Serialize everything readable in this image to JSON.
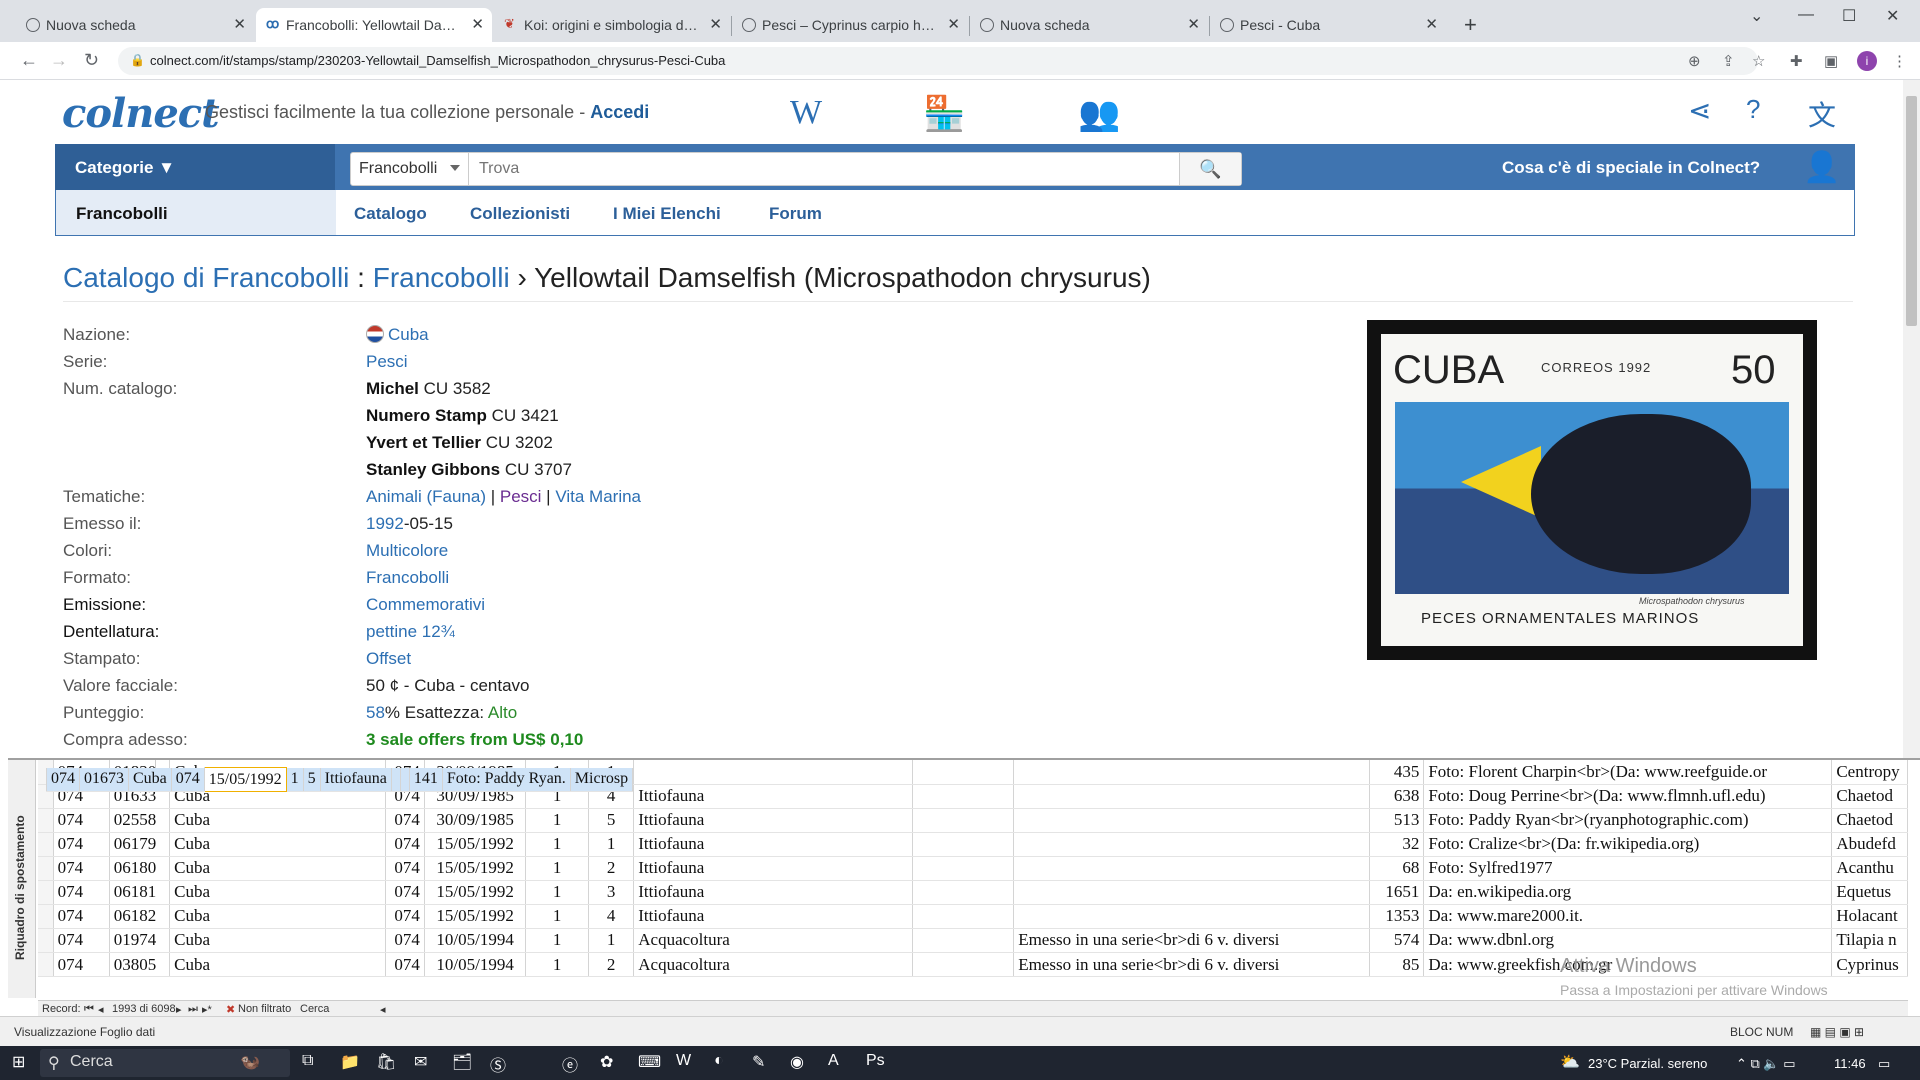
{
  "browser": {
    "tabs": [
      {
        "title": "Nuova scheda",
        "icon": "globe-icon"
      },
      {
        "title": "Francobolli: Yellowtail Damselfish",
        "icon": "colnect-icon"
      },
      {
        "title": "Koi: origini e simbologia della ca",
        "icon": "koi-icon"
      },
      {
        "title": "Pesci – Cyprinus carpio haemator",
        "icon": "globe-icon"
      },
      {
        "title": "Nuova scheda",
        "icon": "globe-icon"
      },
      {
        "title": "Pesci - Cuba",
        "icon": "globe-icon"
      }
    ],
    "url": "colnect.com/it/stamps/stamp/230203-Yellowtail_Damselfish_Microspathodon_chrysurus-Pesci-Cuba",
    "avatar_letter": "i"
  },
  "header": {
    "logo": "colnect",
    "tagline": "Gestisci facilmente la tua collezione personale - ",
    "login": "Accedi",
    "w_icon": "W"
  },
  "searchbar": {
    "categories_label": "Categorie ▼",
    "select_value": "Francobolli",
    "placeholder": "Trova",
    "special": "Cosa c'è di speciale in Colnect?"
  },
  "subnav": {
    "current": "Francobolli",
    "links": [
      "Catalogo",
      "Collezionisti",
      "I Miei Elenchi",
      "Forum"
    ]
  },
  "breadcrumb": {
    "part1": "Catalogo di Francobolli",
    "sep1": " : ",
    "part2": "Francobolli",
    "sep2": " › ",
    "title": "Yellowtail Damselfish (Microspathodon chrysurus)"
  },
  "details": {
    "nazione_label": "Nazione:",
    "nazione": "Cuba",
    "serie_label": "Serie:",
    "serie": "Pesci",
    "numcat_label": "Num. catalogo:",
    "catalogs": [
      {
        "name": "Michel",
        "code": " CU 3582"
      },
      {
        "name": "Numero Stamp",
        "code": " CU 3421"
      },
      {
        "name": "Yvert et Tellier",
        "code": " CU 3202"
      },
      {
        "name": "Stanley Gibbons",
        "code": " CU 3707"
      }
    ],
    "tematiche_label": "Tematiche:",
    "tematiche": [
      "Animali (Fauna)",
      "Pesci",
      "Vita Marina"
    ],
    "tematiche_sep": " | ",
    "emesso_label": "Emesso il:",
    "emesso_year": "1992",
    "emesso_rest": "-05-15",
    "colori_label": "Colori:",
    "colori": "Multicolore",
    "formato_label": "Formato:",
    "formato": "Francobolli",
    "emissione_label": "Emissione:",
    "emissione": "Commemorativi",
    "dentellatura_label": "Dentellatura:",
    "dentellatura": "pettine 12¾",
    "stampato_label": "Stampato:",
    "stampato": "Offset",
    "valore_label": "Valore facciale:",
    "valore": "50 ¢ - Cuba - centavo",
    "punteggio_label": "Punteggio:",
    "punteggio_pct": "58",
    "punteggio_mid": "% Esattezza: ",
    "punteggio_acc": "Alto",
    "compra_label": "Compra adesso:",
    "compra": "3 sale offers from US$  0,10"
  },
  "stamp": {
    "country": "CUBA",
    "correos": "CORREOS 1992",
    "value": "50",
    "scientific": "Microspathodon chrysurus",
    "caption": "PECES ORNAMENTALES MARINOS"
  },
  "access": {
    "nav_pane_label": "Riquadro di spostamento",
    "rows": [
      [
        "074",
        "01830",
        "Cuba",
        "074",
        "30/09/1985",
        "1",
        "1",
        "",
        "",
        "",
        "435",
        "Foto: Florent Charpin<br>(Da: www.reefguide.or",
        "Centropy"
      ],
      [
        "074",
        "01633",
        "Cuba",
        "074",
        "30/09/1985",
        "1",
        "4",
        "Ittiofauna",
        "",
        "",
        "638",
        "Foto: Doug Perrine<br>(Da: www.flmnh.ufl.edu)",
        "Chaetod"
      ],
      [
        "074",
        "02558",
        "Cuba",
        "074",
        "30/09/1985",
        "1",
        "5",
        "Ittiofauna",
        "",
        "",
        "513",
        "Foto: Paddy Ryan<br>(ryanphotographic.com)",
        "Chaetod"
      ],
      [
        "074",
        "06179",
        "Cuba",
        "074",
        "15/05/1992",
        "1",
        "1",
        "Ittiofauna",
        "",
        "",
        "32",
        "Foto: Cralize<br>(Da: fr.wikipedia.org)",
        "Abudefd"
      ],
      [
        "074",
        "06180",
        "Cuba",
        "074",
        "15/05/1992",
        "1",
        "2",
        "Ittiofauna",
        "",
        "",
        "68",
        "Foto: Sylfred1977",
        "Acanthu"
      ],
      [
        "074",
        "06181",
        "Cuba",
        "074",
        "15/05/1992",
        "1",
        "3",
        "Ittiofauna",
        "",
        "",
        "1651",
        "Da: en.wikipedia.org",
        "Equetus"
      ],
      [
        "074",
        "06182",
        "Cuba",
        "074",
        "15/05/1992",
        "1",
        "4",
        "Ittiofauna",
        "",
        "",
        "1353",
        "Da: www.mare2000.it.",
        "Holacant"
      ],
      [
        "074",
        "01673",
        "Cuba",
        "074",
        "15/05/1992",
        "1",
        "5",
        "Ittiofauna",
        "",
        "",
        "141",
        "Foto: Paddy Ryan.",
        "Microsp"
      ],
      [
        "074",
        "01974",
        "Cuba",
        "074",
        "10/05/1994",
        "1",
        "1",
        "Acquacoltura",
        "",
        "Emesso in una serie<br>di 6 v. diversi",
        "574",
        "Da: www.dbnl.org",
        "Tilapia n"
      ],
      [
        "074",
        "03805",
        "Cuba",
        "074",
        "10/05/1994",
        "1",
        "2",
        "Acquacoltura",
        "",
        "Emesso in una serie<br>di 6 v. diversi",
        "85",
        "Da: www.greekfish.com.gr",
        "Cyprinus"
      ]
    ],
    "selected_row": 7,
    "record_label": "Record:",
    "record_pos": "1993 di 6098",
    "filter": "Non filtrato",
    "search": "Cerca",
    "status_left": "Visualizzazione Foglio dati",
    "status_right": "BLOC NUM",
    "watermark": "Attiva Windows",
    "watermark2": "Passa a Impostazioni per attivare Windows"
  },
  "taskbar": {
    "search": "Cerca",
    "weather": "23°C  Parzial. sereno",
    "time": "11:46"
  }
}
